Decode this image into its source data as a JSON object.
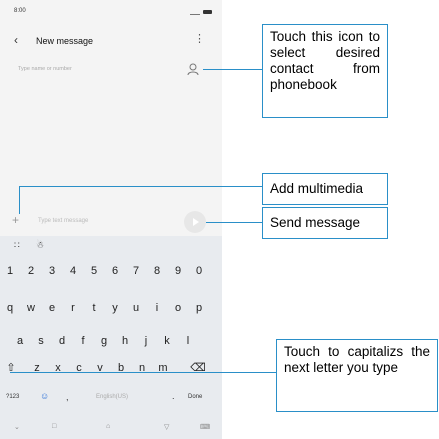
{
  "status": {
    "time": "8:00"
  },
  "header": {
    "back_icon": "back-arrow-icon",
    "title": "New message",
    "menu_icon": "more-vert-icon"
  },
  "recipient": {
    "placeholder": "Type name or number",
    "contact_icon": "person-icon"
  },
  "compose": {
    "add_label": "+",
    "placeholder": "Type text message",
    "send_icon": "send-icon"
  },
  "keyboard": {
    "toolbar": [
      "∷",
      "☃"
    ],
    "numbers": [
      "1",
      "2",
      "3",
      "4",
      "5",
      "6",
      "7",
      "8",
      "9",
      "0"
    ],
    "row1": [
      "q",
      "w",
      "e",
      "r",
      "t",
      "y",
      "u",
      "i",
      "o",
      "p"
    ],
    "row2": [
      "a",
      "s",
      "d",
      "f",
      "g",
      "h",
      "j",
      "k",
      "l"
    ],
    "row3": [
      "z",
      "x",
      "c",
      "v",
      "b",
      "n",
      "m"
    ],
    "shift_label": "⇧",
    "backspace_label": "⌫",
    "sym_label": "?123",
    "emoji_label": "☺",
    "comma_label": ",",
    "space_label": "English(US)",
    "period_label": ".",
    "done_label": "Done"
  },
  "nav": {
    "back": "⌄",
    "home": "□",
    "recents": "⌂",
    "down": "▽",
    "keyboard": "⌨"
  },
  "callouts": {
    "contact": "Touch this icon to select desired contact from phonebook",
    "multimedia": "Add multimedia",
    "send": "Send message",
    "shift": "Touch to capitalizs the next letter you type"
  },
  "colors": {
    "callout_line": "#2a8fc8",
    "keyboard_bg": "#e8ebef"
  }
}
